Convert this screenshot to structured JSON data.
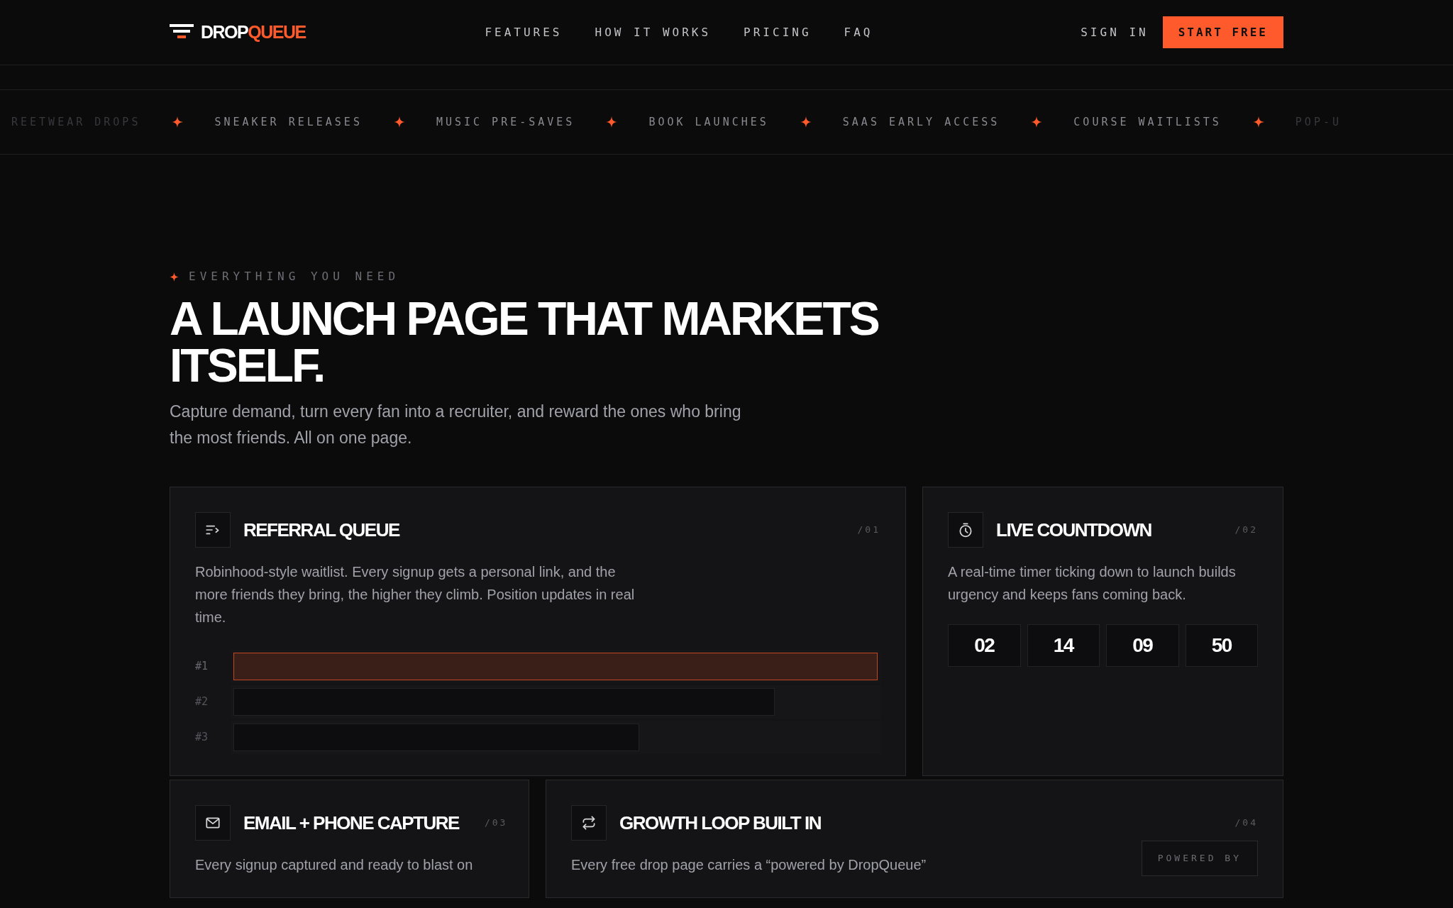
{
  "nav": {
    "logo": {
      "part1": "DROP",
      "part2": "QUEUE"
    },
    "links": [
      "FEATURES",
      "HOW IT WORKS",
      "PRICING",
      "FAQ"
    ],
    "sign_in": "SIGN IN",
    "cta": "START FREE"
  },
  "marquee": [
    {
      "label": "REETWEAR DROPS",
      "faded": true
    },
    {
      "label": "SNEAKER RELEASES",
      "faded": false
    },
    {
      "label": "MUSIC PRE-SAVES",
      "faded": false
    },
    {
      "label": "BOOK LAUNCHES",
      "faded": false
    },
    {
      "label": "SAAS EARLY ACCESS",
      "faded": false
    },
    {
      "label": "COURSE WAITLISTS",
      "faded": false
    },
    {
      "label": "POP-U",
      "faded": true
    }
  ],
  "hero": {
    "eyebrow": "EVERYTHING YOU NEED",
    "title_lines": [
      "A LAUNCH PAGE THAT MARKETS",
      "ITSELF."
    ],
    "subtitle": "Capture demand, turn every fan into a recruiter, and reward the ones who bring the most friends. All on one page."
  },
  "features": [
    {
      "kind": "queue",
      "title": "REFERRAL QUEUE",
      "number": "/01",
      "description": "Robinhood-style waitlist. Every signup gets a personal link, and the more friends they bring, the higher they climb. Position updates in real time.",
      "bars": [
        {
          "label": "#1",
          "level": 1,
          "highlighted": true
        },
        {
          "label": "#2",
          "level": 0.84,
          "highlighted": false
        },
        {
          "label": "#3",
          "level": 0.63,
          "highlighted": false
        }
      ]
    },
    {
      "kind": "countdown",
      "title": "LIVE COUNTDOWN",
      "number": "/02",
      "description": "A real-time timer ticking down to launch builds urgency and keeps fans coming back.",
      "countdown": [
        "02",
        "14",
        "09",
        "50"
      ]
    },
    {
      "kind": "capture",
      "title": "EMAIL + PHONE CAPTURE",
      "number": "/03",
      "description": "Every signup captured and ready to blast on"
    },
    {
      "kind": "growth",
      "title": "GROWTH LOOP BUILT IN",
      "number": "/04",
      "description": "Every free drop page carries a “powered by DropQueue”",
      "badge": "POWERED BY"
    }
  ]
}
